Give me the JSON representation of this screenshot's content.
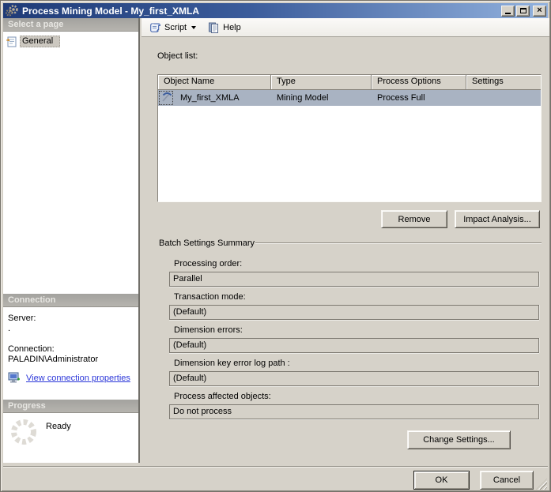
{
  "window": {
    "title": "Process Mining Model - My_first_XMLA",
    "close_glyph": "×"
  },
  "toolbar": {
    "script_label": "Script",
    "help_label": "Help"
  },
  "sidebar": {
    "pages_header": "Select a page",
    "pages": [
      {
        "label": "General"
      }
    ],
    "connection_header": "Connection",
    "server_label": "Server:",
    "server_value": ".",
    "connection_label": "Connection:",
    "connection_value": "PALADIN\\Administrator",
    "link_label": "View connection properties",
    "progress_header": "Progress",
    "progress_status": "Ready"
  },
  "main": {
    "object_list_label": "Object list:",
    "table": {
      "columns": [
        "Object Name",
        "Type",
        "Process Options",
        "Settings"
      ],
      "rows": [
        {
          "name": "My_first_XMLA",
          "type": "Mining Model",
          "process_options": "Process Full",
          "settings": ""
        }
      ]
    },
    "remove_button": "Remove",
    "impact_button": "Impact Analysis...",
    "batch": {
      "title": "Batch Settings Summary",
      "fields": [
        {
          "label": "Processing order:",
          "value": "Parallel"
        },
        {
          "label": "Transaction mode:",
          "value": "(Default)"
        },
        {
          "label": "Dimension errors:",
          "value": "(Default)"
        },
        {
          "label": "Dimension key error log path :",
          "value": "(Default)"
        },
        {
          "label": "Process affected objects:",
          "value": "Do not process"
        }
      ]
    },
    "change_settings_button": "Change Settings..."
  },
  "footer": {
    "ok_label": "OK",
    "cancel_label": "Cancel"
  },
  "colors": {
    "titlebar_start": "#1f3b77",
    "titlebar_end": "#92b2de",
    "face": "#d6d2c9",
    "selected_row": "#a9b3c2",
    "link": "#2b36d9"
  }
}
